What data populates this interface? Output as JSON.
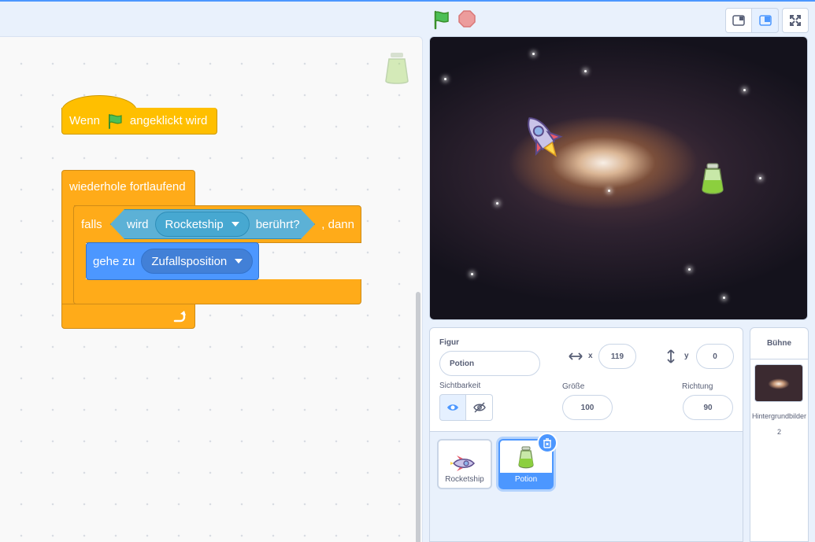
{
  "code": {
    "hat": {
      "text_before": "Wenn",
      "text_after": "angeklickt wird"
    },
    "forever": {
      "label": "wiederhole fortlaufend"
    },
    "if_block": {
      "prefix": "falls",
      "suffix": ", dann"
    },
    "sensing": {
      "label": "wird",
      "target": "Rocketship",
      "suffix": "berührt?"
    },
    "motion": {
      "label": "gehe zu",
      "target": "Zufallsposition"
    }
  },
  "sprite_info": {
    "sprite_label": "Figur",
    "sprite_name": "Potion",
    "x_label": "x",
    "x_value": "119",
    "y_label": "y",
    "y_value": "0",
    "visibility_label": "Sichtbarkeit",
    "size_label": "Größe",
    "size_value": "100",
    "direction_label": "Richtung",
    "direction_value": "90"
  },
  "sprites": [
    {
      "name": "Rocketship",
      "selected": false
    },
    {
      "name": "Potion",
      "selected": true
    }
  ],
  "stage_panel": {
    "title": "Bühne",
    "backdrops_label": "Hintergrundbilder",
    "backdrops_count": "2"
  },
  "colors": {
    "accent": "#4c97ff",
    "events": "#ffbf00",
    "control": "#ffab19",
    "sensing": "#5cb1d6",
    "motion": "#4c97ff"
  }
}
